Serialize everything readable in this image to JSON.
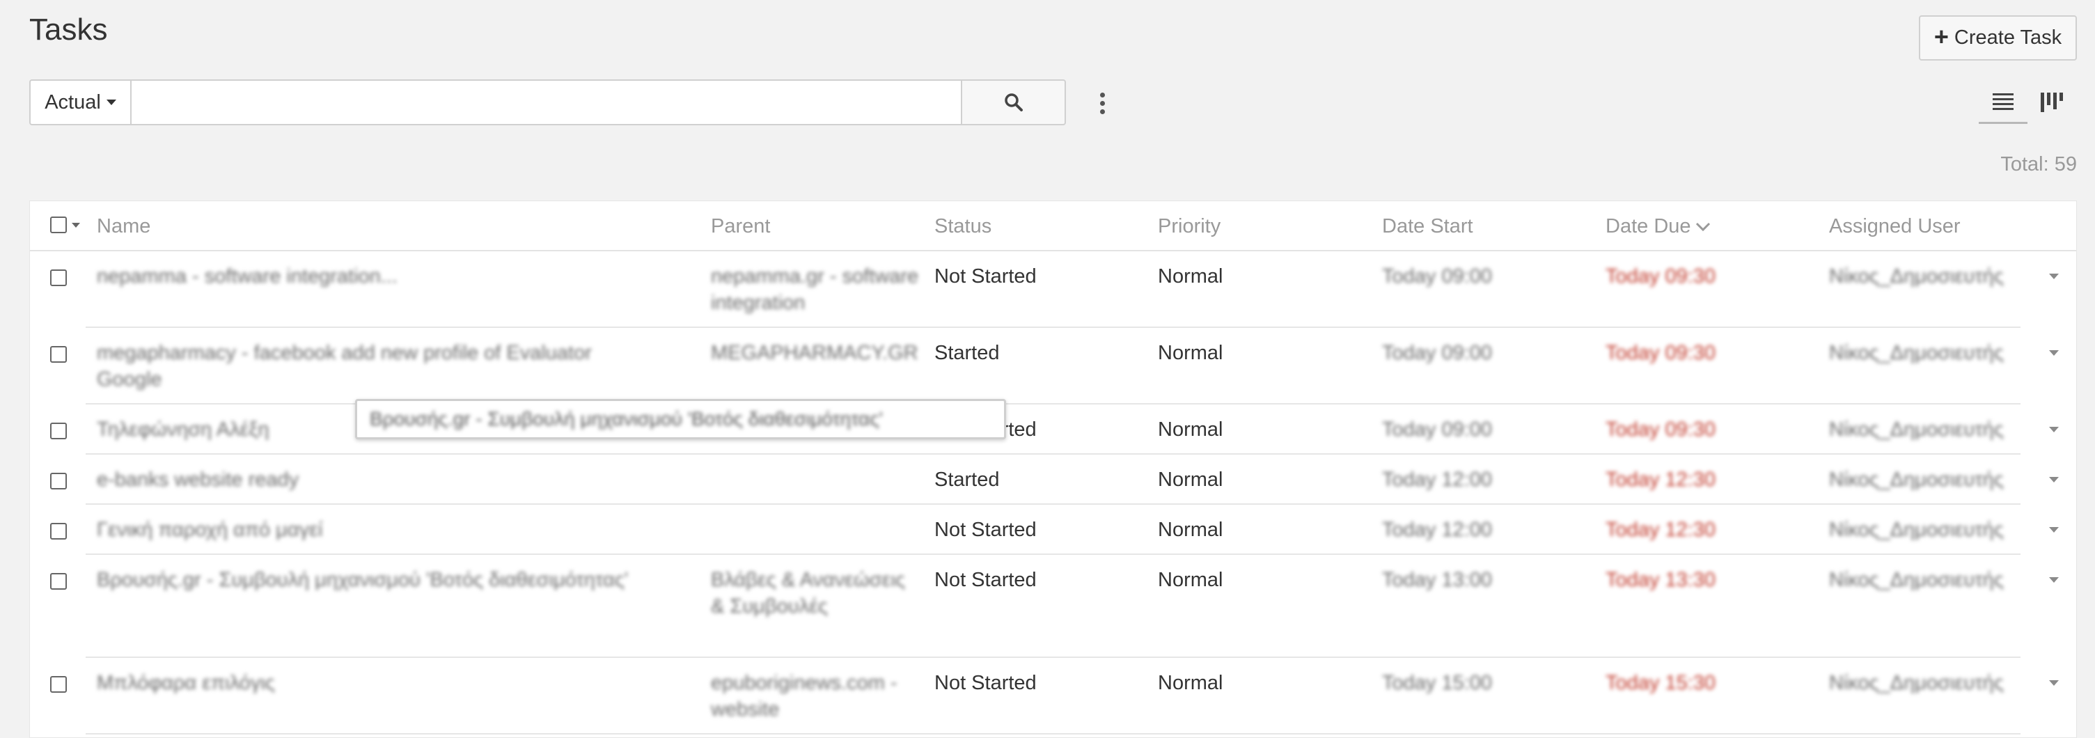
{
  "page": {
    "title": "Tasks"
  },
  "toolbar": {
    "create_label": "Create Task",
    "filter_label": "Actual",
    "search_value": "",
    "search_placeholder": ""
  },
  "total": "Total: 59",
  "columns": [
    "Name",
    "Parent",
    "Status",
    "Priority",
    "Date Start",
    "Date Due",
    "Assigned User"
  ],
  "sort": {
    "column": "Date Due",
    "direction": "desc"
  },
  "rows": [
    {
      "name": [
        "nepamma - software integration..."
      ],
      "parent": [
        "nepamma.gr - software",
        "integration"
      ],
      "status": "Not Started",
      "priority": "Normal",
      "date_start": "Today 09:00",
      "date_due": "Today 09:30",
      "assigned": "Νίκος_Δημοσιευτής"
    },
    {
      "name": [
        "megapharmacy - facebook add new profile of Evaluator",
        "Google"
      ],
      "parent": [
        "MEGAPHARMACY.GR"
      ],
      "status": "Started",
      "priority": "Normal",
      "date_start": "Today 09:00",
      "date_due": "Today 09:30",
      "assigned": "Νίκος_Δημοσιευτής"
    },
    {
      "name": [
        "Τηλεφώνηση Αλέξη"
      ],
      "parent": [],
      "status": "Not Started",
      "priority": "Normal",
      "date_start": "Today 09:00",
      "date_due": "Today 09:30",
      "assigned": "Νίκος_Δημοσιευτής"
    },
    {
      "name": [
        "e-banks website ready"
      ],
      "parent": [],
      "status": "Started",
      "priority": "Normal",
      "date_start": "Today 12:00",
      "date_due": "Today 12:30",
      "assigned": "Νίκος_Δημοσιευτής"
    },
    {
      "name": [
        "Γενική παροχή από μαγεί"
      ],
      "parent": [],
      "status": "Not Started",
      "priority": "Normal",
      "date_start": "Today 12:00",
      "date_due": "Today 12:30",
      "assigned": "Νίκος_Δημοσιευτής"
    },
    {
      "name": [
        "Βρουσής.gr - Συμβουλή μηχανισμού 'Βοτός διαθεσιμότητας'"
      ],
      "parent": [
        "Βλάβες & Ανανεώσεις",
        "& Συμβουλές"
      ],
      "status": "Not Started",
      "priority": "Normal",
      "date_start": "Today 13:00",
      "date_due": "Today 13:30",
      "assigned": "Νίκος_Δημοσιευτής"
    },
    {
      "name": [
        "Μπλόφαρα επιλόγις"
      ],
      "parent": [
        "epuboriginews.com -",
        "website"
      ],
      "status": "Not Started",
      "priority": "Normal",
      "date_start": "Today 15:00",
      "date_due": "Today 15:30",
      "assigned": "Νίκος_Δημοσιευτής"
    }
  ],
  "tooltip": "Βρουσής.gr - Συμβουλή μηχανισμού 'Βοτός διαθεσιμότητας'",
  "icons": {
    "create": "plus-icon",
    "search": "search-icon",
    "menu": "kebab-menu-icon",
    "list_view": "list-view-icon",
    "kanban_view": "kanban-view-icon"
  }
}
